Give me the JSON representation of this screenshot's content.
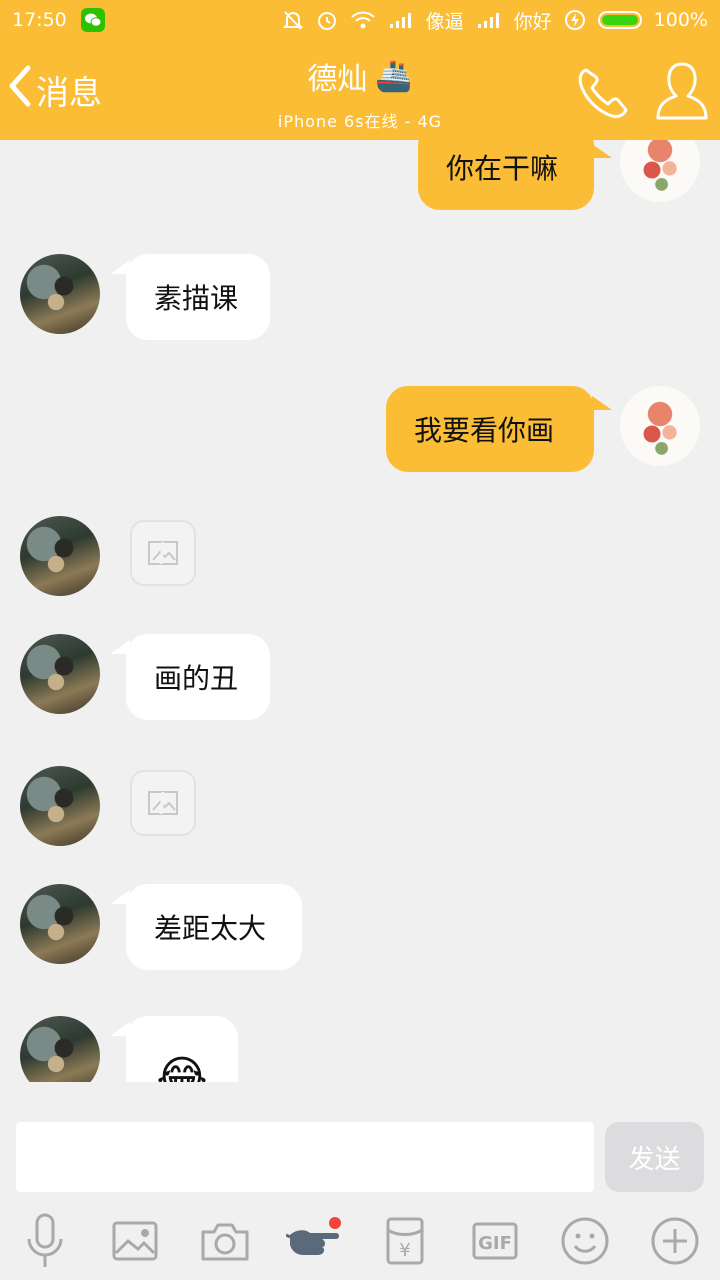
{
  "status": {
    "time": "17:50",
    "carrier1": "像逼",
    "carrier2": "你好",
    "battery": "100%"
  },
  "header": {
    "back_label": "消息",
    "contact_name": "德灿",
    "contact_emoji": "🚢",
    "online_status": "iPhone 6s在线 - 4G"
  },
  "messages": [
    {
      "from": "me",
      "text": "你在干嘛"
    },
    {
      "from": "other",
      "text": "素描课"
    },
    {
      "from": "me",
      "text": "我要看你画"
    },
    {
      "from": "other",
      "type": "image"
    },
    {
      "from": "other",
      "text": "画的丑"
    },
    {
      "from": "other",
      "type": "image"
    },
    {
      "from": "other",
      "text": "差距太大"
    },
    {
      "from": "other",
      "text": "😂"
    }
  ],
  "input": {
    "value": "",
    "send_label": "发送"
  },
  "toolbar": {
    "items": [
      "microphone-icon",
      "image-icon",
      "camera-icon",
      "poke-icon",
      "red-packet-icon",
      "gif-icon",
      "emoji-icon",
      "plus-icon"
    ],
    "gif_label": "GIF",
    "yuan_label": "¥"
  },
  "colors": {
    "accent": "#fbbd35",
    "bubble_in": "#ffffff",
    "background": "#f0f0f0"
  }
}
